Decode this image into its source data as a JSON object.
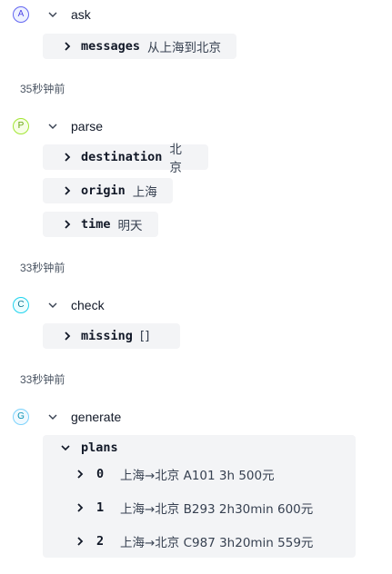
{
  "steps": [
    {
      "badge": "A",
      "name": "ask",
      "badge_color": "#4f46e5",
      "badge_bg": "#eef2ff",
      "fields": [
        {
          "key": "messages",
          "value": "从上海到北京"
        }
      ],
      "time": "35秒钟前"
    },
    {
      "badge": "P",
      "name": "parse",
      "badge_color": "#65a30d",
      "badge_bg": "#f7fee7",
      "fields": [
        {
          "key": "destination",
          "value": "北京"
        },
        {
          "key": "origin",
          "value": "上海"
        },
        {
          "key": "time",
          "value": "明天"
        }
      ],
      "time": "33秒钟前"
    },
    {
      "badge": "C",
      "name": "check",
      "badge_color": "#0e7490",
      "badge_bg": "#ecfeff",
      "fields": [
        {
          "key": "missing",
          "value": "[]"
        }
      ],
      "time": "33秒钟前"
    },
    {
      "badge": "G",
      "name": "generate",
      "badge_color": "#0891b2",
      "badge_bg": "#f0f9ff",
      "plans_key": "plans",
      "plans": [
        {
          "index": "0",
          "value": "上海→北京 A101 3h 500元"
        },
        {
          "index": "1",
          "value": "上海→北京 B293 2h30min 600元"
        },
        {
          "index": "2",
          "value": "上海→北京 C987 3h20min 559元"
        }
      ]
    }
  ],
  "icons": {
    "expanded": "chevron-down-icon",
    "collapsed": "chevron-right-icon"
  }
}
